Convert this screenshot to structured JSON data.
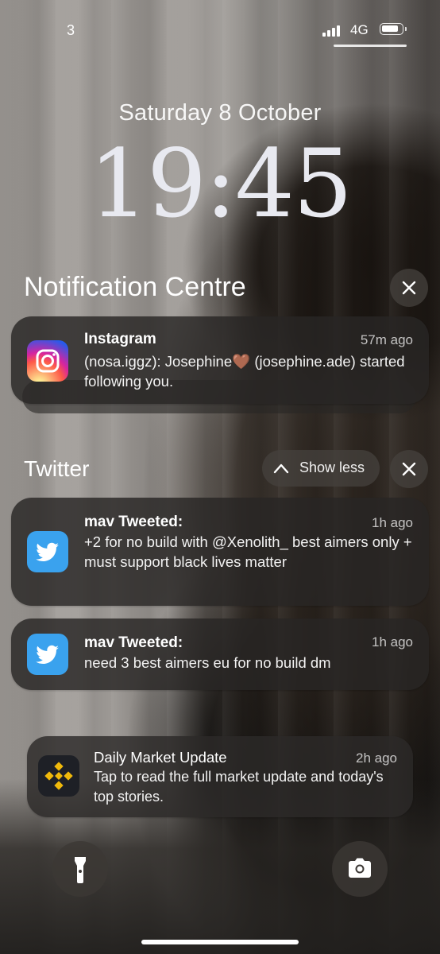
{
  "status_bar": {
    "carrier": "3",
    "network": "4G"
  },
  "lock": {
    "date": "Saturday 8 October",
    "time": "19:45"
  },
  "notification_centre": {
    "title": "Notification Centre",
    "instagram": {
      "app": "Instagram",
      "time": "57m ago",
      "body": "(nosa.iggz): Josephine🤎 (josephine.ade) started following you."
    }
  },
  "twitter_group": {
    "title": "Twitter",
    "show_less_label": "Show less",
    "items": [
      {
        "title": "mav Tweeted:",
        "time": "1h ago",
        "body": "+2 for no build with @Xenolith_ best aimers only + must support black lives matter"
      },
      {
        "title": "mav Tweeted:",
        "time": "1h ago",
        "body": "need 3 best aimers eu for no build dm"
      }
    ]
  },
  "market": {
    "title": "Daily Market Update",
    "time": "2h ago",
    "body": "Tap to read the full market update and today's top stories."
  },
  "icons": [
    "signal-icon",
    "battery-icon",
    "close-icon",
    "instagram-icon",
    "chevron-up-icon",
    "twitter-icon",
    "binance-icon",
    "flashlight-icon",
    "camera-icon"
  ],
  "colors": {
    "twitter_blue": "#3aa2ee",
    "binance_yellow": "#f0b90b"
  }
}
